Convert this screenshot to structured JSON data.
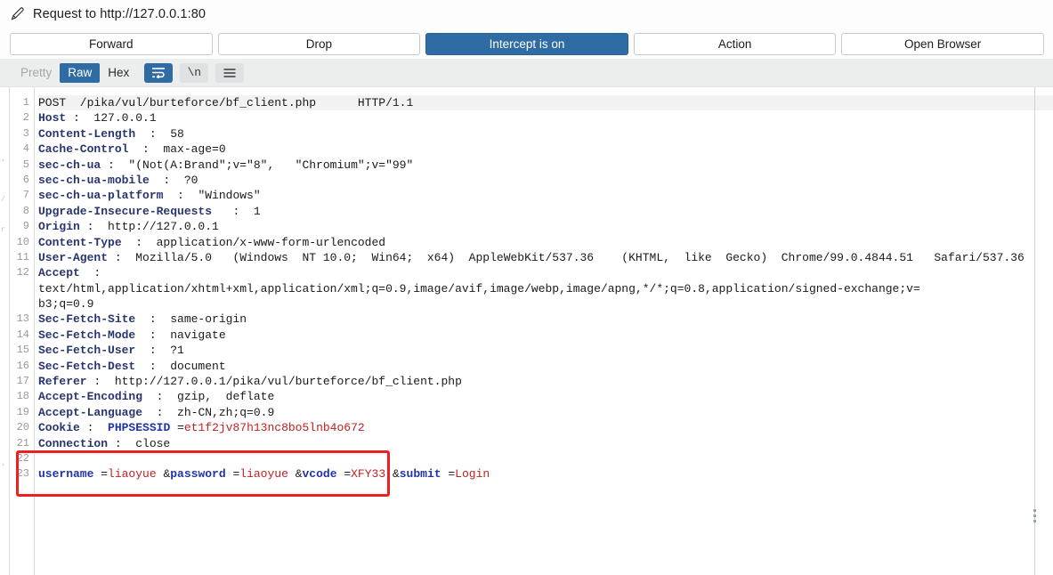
{
  "window": {
    "title": "Request to http://127.0.0.1:80",
    "icon": "pencil-icon"
  },
  "toolbar": {
    "forward_label": "Forward",
    "drop_label": "Drop",
    "intercept_label": "Intercept is on",
    "action_label": "Action",
    "open_browser_label": "Open Browser",
    "accent_color": "#2f6ca3"
  },
  "viewbar": {
    "tabs": [
      {
        "label": "Pretty",
        "state": "muted"
      },
      {
        "label": "Raw",
        "state": "active"
      },
      {
        "label": "Hex",
        "state": "plain"
      }
    ],
    "icons": [
      {
        "name": "word-wrap-icon",
        "state": "active"
      },
      {
        "name": "newline-icon",
        "glyph": "\\n",
        "state": "inactive"
      },
      {
        "name": "menu-icon",
        "state": "inactive"
      }
    ]
  },
  "request": {
    "lines": [
      {
        "num": "1",
        "highlight": true,
        "segments": [
          {
            "text": "POST  /pika/vul/burteforce/bf_client.php      HTTP/1.1",
            "cls": "plain"
          }
        ]
      },
      {
        "num": "2",
        "segments": [
          {
            "text": "Host",
            "cls": "hname"
          },
          {
            "text": " :  127.0.0.1",
            "cls": "hval"
          }
        ]
      },
      {
        "num": "3",
        "segments": [
          {
            "text": "Content-Length",
            "cls": "hname"
          },
          {
            "text": "  :  58",
            "cls": "hval"
          }
        ]
      },
      {
        "num": "4",
        "segments": [
          {
            "text": "Cache-Control",
            "cls": "hname"
          },
          {
            "text": "  :  max-age=0",
            "cls": "hval"
          }
        ]
      },
      {
        "num": "5",
        "segments": [
          {
            "text": "sec-ch-ua",
            "cls": "hname"
          },
          {
            "text": " :  \"(Not(A:Brand\";v=\"8\",   \"Chromium\";v=\"99\"",
            "cls": "hval"
          }
        ]
      },
      {
        "num": "6",
        "segments": [
          {
            "text": "sec-ch-ua-mobile",
            "cls": "hname"
          },
          {
            "text": "  :  ?0",
            "cls": "hval"
          }
        ]
      },
      {
        "num": "7",
        "segments": [
          {
            "text": "sec-ch-ua-platform",
            "cls": "hname"
          },
          {
            "text": "  :  \"Windows\"",
            "cls": "hval"
          }
        ]
      },
      {
        "num": "8",
        "segments": [
          {
            "text": "Upgrade-Insecure-Requests",
            "cls": "hname"
          },
          {
            "text": "   :  1",
            "cls": "hval"
          }
        ]
      },
      {
        "num": "9",
        "segments": [
          {
            "text": "Origin",
            "cls": "hname"
          },
          {
            "text": " :  http://127.0.0.1",
            "cls": "hval"
          }
        ]
      },
      {
        "num": "10",
        "segments": [
          {
            "text": "Content-Type",
            "cls": "hname"
          },
          {
            "text": "  :  application/x-www-form-urlencoded",
            "cls": "hval"
          }
        ]
      },
      {
        "num": "11",
        "segments": [
          {
            "text": "User-Agent",
            "cls": "hname"
          },
          {
            "text": " :  Mozilla/5.0   (Windows  NT 10.0;  Win64;  x64)  AppleWebKit/537.36    (KHTML,  like  Gecko)  Chrome/99.0.4844.51   Safari/537.36",
            "cls": "hval"
          }
        ]
      },
      {
        "num": "12",
        "segments": [
          {
            "text": "Accept",
            "cls": "hname"
          },
          {
            "text": "  :",
            "cls": "hval"
          }
        ]
      },
      {
        "num": "",
        "segments": [
          {
            "text": "text/html,application/xhtml+xml,application/xml;q=0.9,image/avif,image/webp,image/apng,*/*;q=0.8,application/signed-exchange;v=",
            "cls": "hval"
          }
        ]
      },
      {
        "num": "",
        "segments": [
          {
            "text": "b3;q=0.9",
            "cls": "hval"
          }
        ]
      },
      {
        "num": "13",
        "segments": [
          {
            "text": "Sec-Fetch-Site",
            "cls": "hname"
          },
          {
            "text": "  :  same-origin",
            "cls": "hval"
          }
        ]
      },
      {
        "num": "14",
        "segments": [
          {
            "text": "Sec-Fetch-Mode",
            "cls": "hname"
          },
          {
            "text": "  :  navigate",
            "cls": "hval"
          }
        ]
      },
      {
        "num": "15",
        "segments": [
          {
            "text": "Sec-Fetch-User",
            "cls": "hname"
          },
          {
            "text": "  :  ?1",
            "cls": "hval"
          }
        ]
      },
      {
        "num": "16",
        "segments": [
          {
            "text": "Sec-Fetch-Dest",
            "cls": "hname"
          },
          {
            "text": "  :  document",
            "cls": "hval"
          }
        ]
      },
      {
        "num": "17",
        "segments": [
          {
            "text": "Referer",
            "cls": "hname"
          },
          {
            "text": " :  http://127.0.0.1/pika/vul/burteforce/bf_client.php",
            "cls": "hval"
          }
        ]
      },
      {
        "num": "18",
        "segments": [
          {
            "text": "Accept-Encoding",
            "cls": "hname"
          },
          {
            "text": "  :  gzip,  deflate",
            "cls": "hval"
          }
        ]
      },
      {
        "num": "19",
        "segments": [
          {
            "text": "Accept-Language",
            "cls": "hname"
          },
          {
            "text": "  :  zh-CN,zh;q=0.9",
            "cls": "hval"
          }
        ]
      },
      {
        "num": "20",
        "segments": [
          {
            "text": "Cookie",
            "cls": "hname"
          },
          {
            "text": " :  ",
            "cls": "hval"
          },
          {
            "text": "PHPSESSID",
            "cls": "pname"
          },
          {
            "text": " =",
            "cls": "punct"
          },
          {
            "text": "et1f2jv87h13nc8bo5lnb4o672",
            "cls": "pval"
          }
        ]
      },
      {
        "num": "21",
        "segments": [
          {
            "text": "Connection",
            "cls": "hname"
          },
          {
            "text": " :  close",
            "cls": "hval"
          }
        ]
      },
      {
        "num": "22",
        "segments": [
          {
            "text": "",
            "cls": "plain"
          }
        ]
      },
      {
        "num": "23",
        "segments": [
          {
            "text": "username",
            "cls": "pname"
          },
          {
            "text": " =",
            "cls": "punct"
          },
          {
            "text": "liaoyue",
            "cls": "pval"
          },
          {
            "text": " &",
            "cls": "punct"
          },
          {
            "text": "password",
            "cls": "pname"
          },
          {
            "text": " =",
            "cls": "punct"
          },
          {
            "text": "liaoyue",
            "cls": "pval"
          },
          {
            "text": " &",
            "cls": "punct"
          },
          {
            "text": "vcode",
            "cls": "pname"
          },
          {
            "text": " =",
            "cls": "punct"
          },
          {
            "text": "XFY33",
            "cls": "pval"
          },
          {
            "text": " &",
            "cls": "punct"
          },
          {
            "text": "submit",
            "cls": "pname"
          },
          {
            "text": " =",
            "cls": "punct"
          },
          {
            "text": "Login",
            "cls": "pval"
          }
        ]
      }
    ]
  },
  "annotation": {
    "color": "#ef1f1f",
    "target": "post-body-parameters"
  }
}
